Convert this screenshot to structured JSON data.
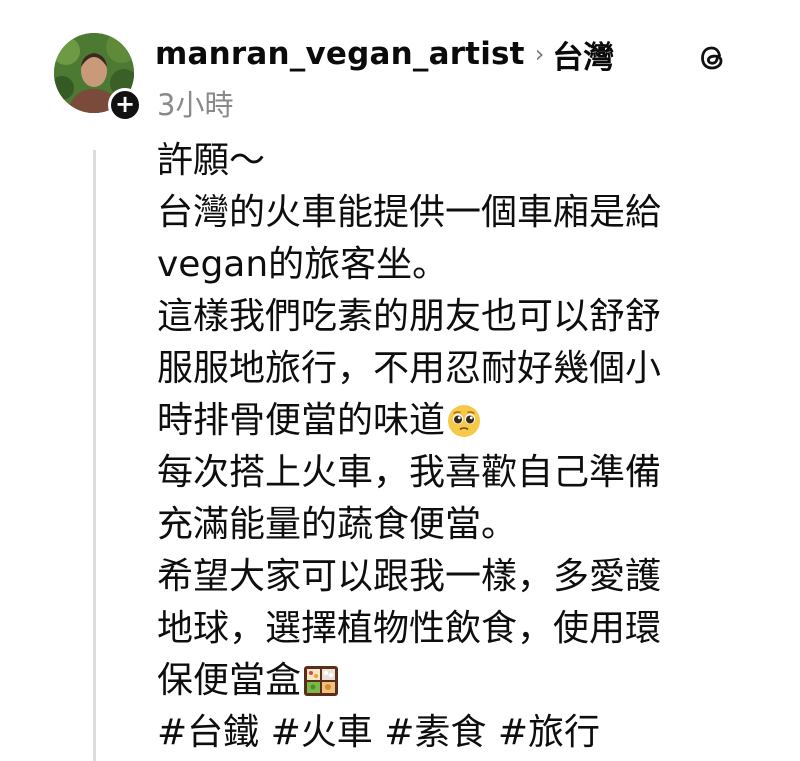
{
  "post": {
    "username": "manran_vegan_artist",
    "chevron_glyph": "›",
    "topic": "台灣",
    "timestamp": "3小時",
    "follow_glyph": "+",
    "body_lines": [
      "許願～",
      "台灣的火車能提供一個車廂是給",
      "vegan的旅客坐。",
      "這樣我們吃素的朋友也可以舒舒",
      "服服地旅行，不用忍耐好幾個小",
      "時排骨便當的味道",
      "每次搭上火車，我喜歡自己準備",
      "充滿能量的蔬食便當。",
      "希望大家可以跟我一樣，多愛護",
      "地球，選擇植物性飲食，使用環",
      "保便當盒"
    ],
    "hashtags": [
      "#台鐵",
      "#火車",
      "#素食",
      "#旅行"
    ],
    "icons": {
      "avatar": "avatar-photo",
      "follow": "plus-icon",
      "logo": "threads-logo-icon",
      "emoji_1": "pleading-face-emoji",
      "emoji_2": "bento-box-emoji"
    }
  }
}
